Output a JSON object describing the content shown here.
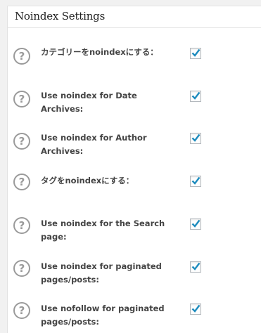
{
  "panel": {
    "title": "Noindex Settings"
  },
  "colors": {
    "check": "#1e8cbe",
    "help_icon": "#9a9a9a"
  },
  "settings": [
    {
      "label": "カテゴリーをnoindexにする：",
      "checked": true,
      "icon": "help-icon"
    },
    {
      "label": "Use noindex for Date Archives:",
      "checked": true,
      "icon": "help-icon"
    },
    {
      "label": "Use noindex for Author Archives:",
      "checked": true,
      "icon": "help-icon"
    },
    {
      "label": "タグをnoindexにする：",
      "checked": true,
      "icon": "help-icon"
    },
    {
      "label": "Use noindex for the Search page:",
      "checked": true,
      "icon": "help-icon"
    },
    {
      "label": "Use noindex for paginated pages/posts:",
      "checked": true,
      "icon": "help-icon"
    },
    {
      "label": "Use nofollow for paginated pages/posts:",
      "checked": true,
      "icon": "help-icon"
    }
  ]
}
